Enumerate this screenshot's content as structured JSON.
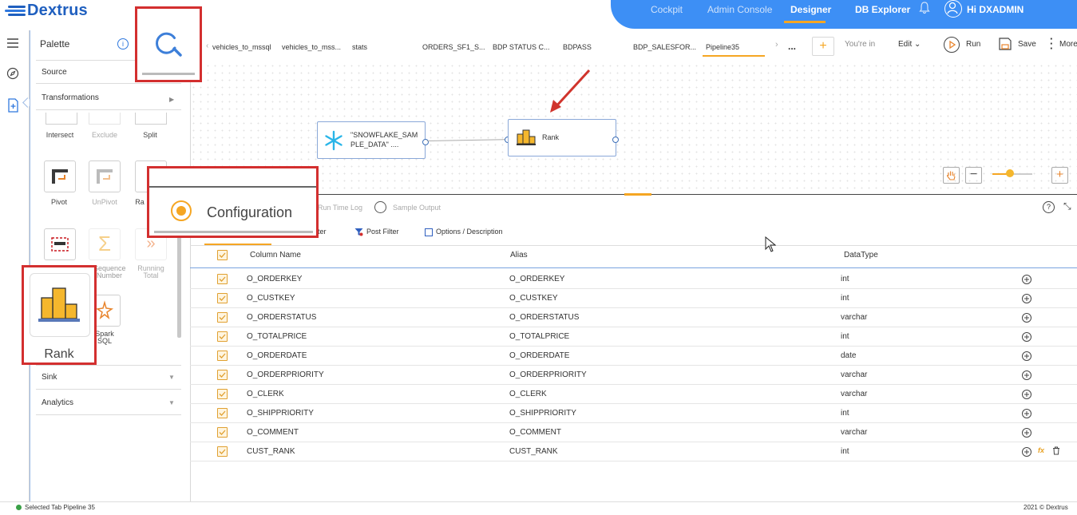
{
  "app": {
    "logo": "Dextrus"
  },
  "nav": {
    "items": [
      "Cockpit",
      "Admin Console",
      "Designer",
      "DB Explorer"
    ],
    "user": "Hi DXADMIN"
  },
  "palette": {
    "title": "Palette",
    "sections": {
      "source": "Source",
      "transformations": "Transformations",
      "sink": "Sink",
      "analytics": "Analytics"
    },
    "tools": [
      "Intersect",
      "Exclude",
      "Split",
      "Pivot",
      "UnPivot",
      "Ra",
      "Sequence Number",
      "Running Total",
      "Spark SQL"
    ]
  },
  "tabs": [
    "vehicles_to_mssql",
    "vehicles_to_mss...",
    "stats",
    "ORDERS_SF1_S...",
    "BDP STATUS C...",
    "BDPASS",
    "BDP_SALESFOR...",
    "Pipeline35",
    "..."
  ],
  "toolbar": {
    "youre_in": "You're in",
    "edit": "Edit",
    "run": "Run",
    "save": "Save",
    "more": "More"
  },
  "nodes": {
    "snowflake": "\"SNOWFLAKE_SAMPLE_DATA\" ....",
    "rank": "Rank"
  },
  "panel": {
    "tabs": {
      "config": "Configuration",
      "runtime": "Run Time Log",
      "sample": "Sample Output"
    },
    "subtabs": {
      "prefilter": "ter",
      "postfilter": "Post Filter",
      "options": "Options / Description"
    },
    "headers": {
      "column": "Column Name",
      "alias": "Alias",
      "datatype": "DataType"
    },
    "rows": [
      {
        "col": "O_ORDERKEY",
        "alias": "O_ORDERKEY",
        "type": "int"
      },
      {
        "col": "O_CUSTKEY",
        "alias": "O_CUSTKEY",
        "type": "int"
      },
      {
        "col": "O_ORDERSTATUS",
        "alias": "O_ORDERSTATUS",
        "type": "varchar"
      },
      {
        "col": "O_TOTALPRICE",
        "alias": "O_TOTALPRICE",
        "type": "int"
      },
      {
        "col": "O_ORDERDATE",
        "alias": "O_ORDERDATE",
        "type": "date"
      },
      {
        "col": "O_ORDERPRIORITY",
        "alias": "O_ORDERPRIORITY",
        "type": "varchar"
      },
      {
        "col": "O_CLERK",
        "alias": "O_CLERK",
        "type": "varchar"
      },
      {
        "col": "O_SHIPPRIORITY",
        "alias": "O_SHIPPRIORITY",
        "type": "int"
      },
      {
        "col": "O_COMMENT",
        "alias": "O_COMMENT",
        "type": "varchar"
      },
      {
        "col": "CUST_RANK",
        "alias": "CUST_RANK",
        "type": "int"
      }
    ]
  },
  "callouts": {
    "config": "Configuration",
    "rank": "Rank"
  },
  "footer": {
    "left": "Selected Tab Pipeline 35",
    "right": "2021 © Dextrus"
  },
  "colors": {
    "accent": "#f5a623",
    "brand": "#3d8ff5",
    "highlight": "#d32f2f"
  }
}
